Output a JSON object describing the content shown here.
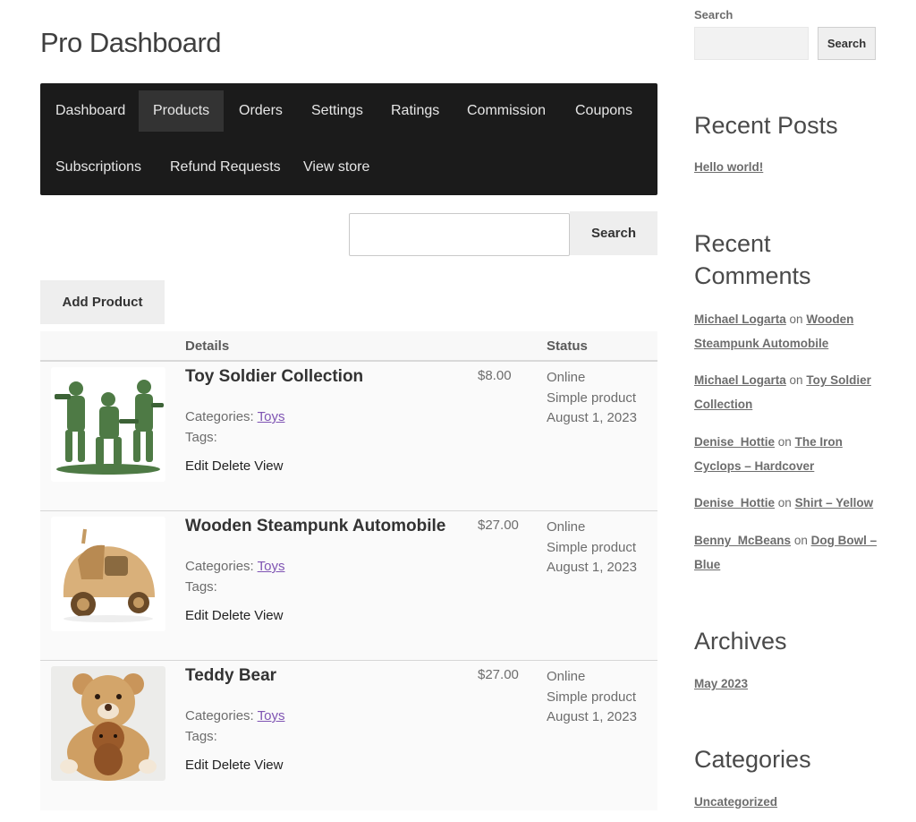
{
  "page": {
    "title": "Pro Dashboard"
  },
  "nav": {
    "items": [
      {
        "label": "Dashboard",
        "active": false
      },
      {
        "label": "Products",
        "active": true
      },
      {
        "label": "Orders",
        "active": false
      },
      {
        "label": "Settings",
        "active": false
      },
      {
        "label": "Ratings",
        "active": false
      },
      {
        "label": "Commission",
        "active": false
      },
      {
        "label": "Coupons",
        "active": false
      },
      {
        "label": "Subscriptions",
        "active": false
      },
      {
        "label": "Refund Requests",
        "active": false
      },
      {
        "label": "View store",
        "active": false
      }
    ]
  },
  "product_search": {
    "value": "",
    "placeholder": "",
    "button_label": "Search"
  },
  "add_product_label": "Add Product",
  "table": {
    "headers": {
      "image": "",
      "details": "Details",
      "price": "",
      "status": "Status"
    },
    "rows": [
      {
        "image_icon": "toy-soldier-image",
        "name": "Toy Soldier Collection",
        "categories_label": "Categories:",
        "category": "Toys",
        "tags_label": "Tags:",
        "actions": [
          "Edit",
          "Delete",
          "View"
        ],
        "price": "$8.00",
        "status": "Online",
        "type": "Simple product",
        "date": "August 1, 2023"
      },
      {
        "image_icon": "wooden-car-image",
        "name": "Wooden Steampunk Automobile",
        "categories_label": "Categories:",
        "category": "Toys",
        "tags_label": "Tags:",
        "actions": [
          "Edit",
          "Delete",
          "View"
        ],
        "price": "$27.00",
        "status": "Online",
        "type": "Simple product",
        "date": "August 1, 2023"
      },
      {
        "image_icon": "teddy-bear-image",
        "name": "Teddy Bear",
        "categories_label": "Categories:",
        "category": "Toys",
        "tags_label": "Tags:",
        "actions": [
          "Edit",
          "Delete",
          "View"
        ],
        "price": "$27.00",
        "status": "Online",
        "type": "Simple product",
        "date": "August 1, 2023"
      }
    ]
  },
  "sidebar": {
    "search": {
      "label": "Search",
      "value": "",
      "button_label": "Search"
    },
    "recent_posts": {
      "title": "Recent Posts",
      "items": [
        "Hello world!"
      ]
    },
    "recent_comments": {
      "title_line1": "Recent",
      "title_line2": "Comments",
      "connector": "on",
      "items": [
        {
          "author": "Michael Logarta",
          "post": "Wooden Steampunk Automobile"
        },
        {
          "author": "Michael Logarta",
          "post": "Toy Soldier Collection"
        },
        {
          "author": "Denise_Hottie",
          "post": "The Iron Cyclops – Hardcover"
        },
        {
          "author": "Denise_Hottie",
          "post": "Shirt – Yellow"
        },
        {
          "author": "Benny_McBeans",
          "post": "Dog Bowl – Blue"
        }
      ]
    },
    "archives": {
      "title": "Archives",
      "items": [
        "May 2023"
      ]
    },
    "categories": {
      "title": "Categories",
      "items": [
        "Uncategorized"
      ]
    }
  },
  "colors": {
    "nav_bg": "#1b1b1b",
    "nav_active": "#333333",
    "link_purple": "#7f54b3"
  }
}
